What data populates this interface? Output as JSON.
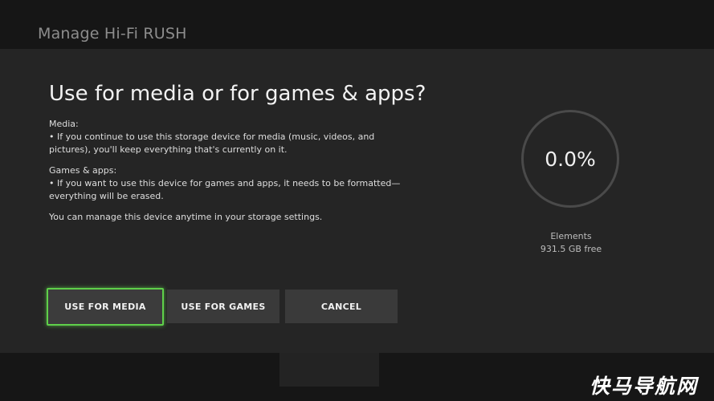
{
  "background": {
    "title": "Manage Hi-Fi RUSH"
  },
  "dialog": {
    "heading": "Use for media or for games & apps?",
    "media_heading": "Media:",
    "media_text": "• If you continue to use this storage device for media (music, videos, and pictures), you'll keep everything that's currently on it.",
    "games_heading": "Games & apps:",
    "games_text": "• If you want to use this device for games and apps, it needs to be formatted—everything will be erased.",
    "footer_text": "You can manage this device anytime in your storage settings."
  },
  "storage": {
    "usage_percent": "0.0%",
    "usage_fraction": 0.0,
    "drive_name": "Elements",
    "free_space": "931.5 GB free"
  },
  "buttons": {
    "use_for_media": "USE FOR MEDIA",
    "use_for_games": "USE FOR GAMES",
    "cancel": "CANCEL"
  },
  "watermark": "快马导航网",
  "colors": {
    "focus": "#5fd04a",
    "dialog_bg": "#252525",
    "button_bg": "#3a3a3a"
  }
}
